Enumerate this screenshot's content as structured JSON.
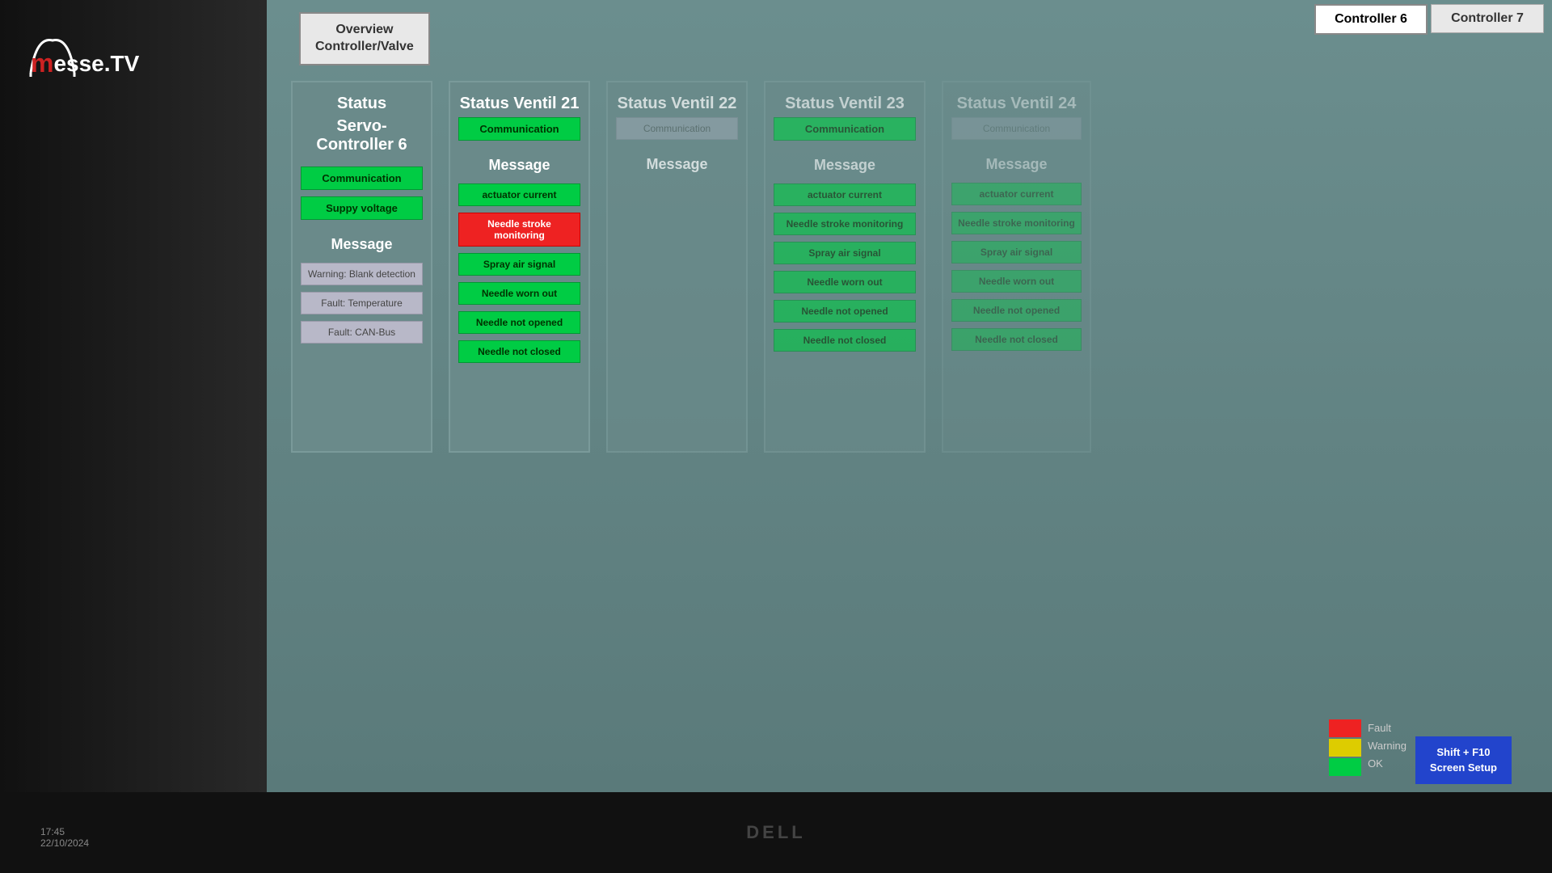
{
  "logo": {
    "brand": "messe.TV"
  },
  "topNav": {
    "overview_label": "Overview\nController/Valve",
    "controller6_label": "Controller 6",
    "controller7_label": "Controller 7"
  },
  "servoController": {
    "title": "Status",
    "subtitle": "Servo-Controller 6",
    "communication_label": "Communication",
    "supply_voltage_label": "Suppy voltage",
    "message_label": "Message",
    "messages": [
      {
        "label": "Warning: Blank detection",
        "type": "gray"
      },
      {
        "label": "Fault: Temperature",
        "type": "gray"
      },
      {
        "label": "Fault: CAN-Bus",
        "type": "gray"
      }
    ]
  },
  "ventil21": {
    "title": "Status Ventil 21",
    "communication_label": "Communication",
    "message_label": "Message",
    "messages": [
      {
        "label": "actuator current",
        "type": "green"
      },
      {
        "label": "Needle stroke monitoring",
        "type": "red"
      },
      {
        "label": "Spray air signal",
        "type": "green"
      },
      {
        "label": "Needle worn out",
        "type": "green"
      },
      {
        "label": "Needle not opened",
        "type": "green"
      },
      {
        "label": "Needle not closed",
        "type": "green"
      }
    ]
  },
  "ventil22": {
    "title": "Status Ventil 22",
    "communication_label": "Communication",
    "message_label": "Message",
    "messages": []
  },
  "ventil23": {
    "title": "Status Ventil 23",
    "communication_label": "Communication",
    "message_label": "Message",
    "messages": [
      {
        "label": "actuator current",
        "type": "green"
      },
      {
        "label": "Needle stroke monitoring",
        "type": "green"
      },
      {
        "label": "Spray air signal",
        "type": "green"
      },
      {
        "label": "Needle worn out",
        "type": "green"
      },
      {
        "label": "Needle not opened",
        "type": "green"
      },
      {
        "label": "Needle not closed",
        "type": "green"
      }
    ]
  },
  "ventil24": {
    "title": "Status Ventil 24",
    "communication_label": "Communication",
    "message_label": "Message",
    "messages": [
      {
        "label": "actuator current",
        "type": "green"
      },
      {
        "label": "Needle stroke monitoring",
        "type": "green"
      },
      {
        "label": "Spray air signal",
        "type": "green"
      },
      {
        "label": "Needle worn out",
        "type": "green"
      },
      {
        "label": "Needle not opened",
        "type": "green"
      },
      {
        "label": "Needle not closed",
        "type": "green"
      }
    ]
  },
  "legend": {
    "red_label": "Fault",
    "yellow_label": "Warning",
    "green_label": "OK"
  },
  "bottomRight": {
    "btn_label": "Shift + F10\nScreen Setup"
  },
  "monitor": {
    "brand": "DELL",
    "time": "17:45\n22/10/2024"
  }
}
